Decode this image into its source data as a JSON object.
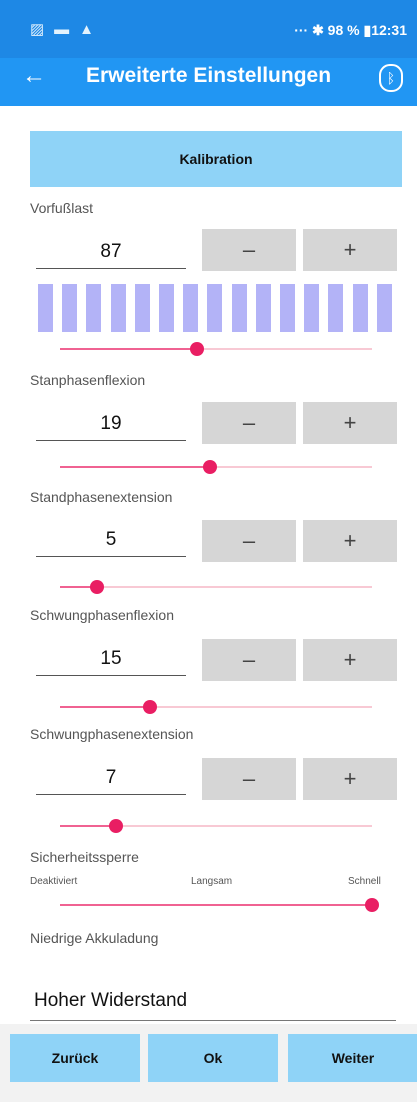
{
  "status_bar": {
    "left_icons": [
      "notification-icon",
      "image-icon",
      "warning-icon"
    ],
    "right": "··· ✱ 98 % ▮12:31"
  },
  "app_bar": {
    "title": "Erweiterte Einstellungen",
    "back": "←",
    "bluetooth": "ᛒ"
  },
  "kalibration": "Kalibration",
  "controls": {
    "minus": "–",
    "plus": "+"
  },
  "vorfusslast": {
    "label": "Vorfußlast",
    "value": "87",
    "slider": 0.44
  },
  "stanphasenflexion": {
    "label": "Stanphasenflexion",
    "value": "19",
    "slider": 0.48
  },
  "standphasenextension": {
    "label": "Standphasenextension",
    "value": "5",
    "slider": 0.12
  },
  "schwungphasenflexion": {
    "label": "Schwungphasenflexion",
    "value": "15",
    "slider": 0.29
  },
  "schwungphasenextension": {
    "label": "Schwungphasenextension",
    "value": "7",
    "slider": 0.18
  },
  "sicherheitssperre": {
    "label": "Sicherheitssperre",
    "options": [
      "Deaktiviert",
      "Langsam",
      "Schnell"
    ],
    "slider": 1.0
  },
  "akkuladung": {
    "label": "Niedrige Akkuladung",
    "value": "Hoher Widerstand"
  },
  "footer": {
    "back": "Zurück",
    "ok": "Ok",
    "next": "Weiter"
  },
  "colors": {
    "primary": "#2196f3",
    "button": "#8fd3f7",
    "accent": "#e91e63"
  }
}
